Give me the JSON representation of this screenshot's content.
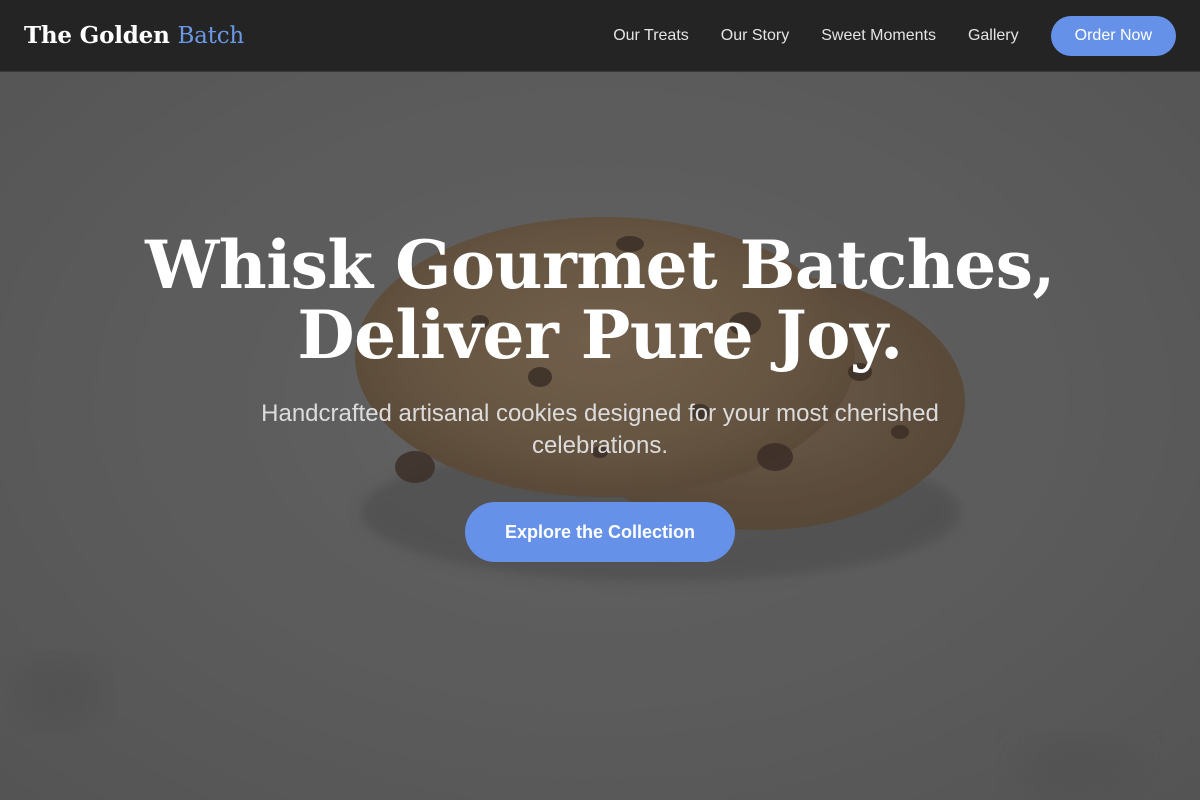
{
  "nav": {
    "logo_main": "The Golden",
    "logo_accent": "Batch",
    "links": [
      "Our Treats",
      "Our Story",
      "Sweet Moments",
      "Gallery"
    ],
    "cta_label": "Order Now"
  },
  "hero": {
    "title_line1": "Whisk Gourmet Batches,",
    "title_line2": "Deliver Pure Joy.",
    "subtitle": "Handcrafted artisanal cookies designed for your most cherished celebrations.",
    "button_label": "Explore the Collection",
    "background_image": "chocolate-chip-cookies-photo"
  },
  "colors": {
    "nav_background": "#242424",
    "accent": "#6592e8",
    "logo_accent": "#6b98e6",
    "overlay": "#5f5f5f"
  }
}
